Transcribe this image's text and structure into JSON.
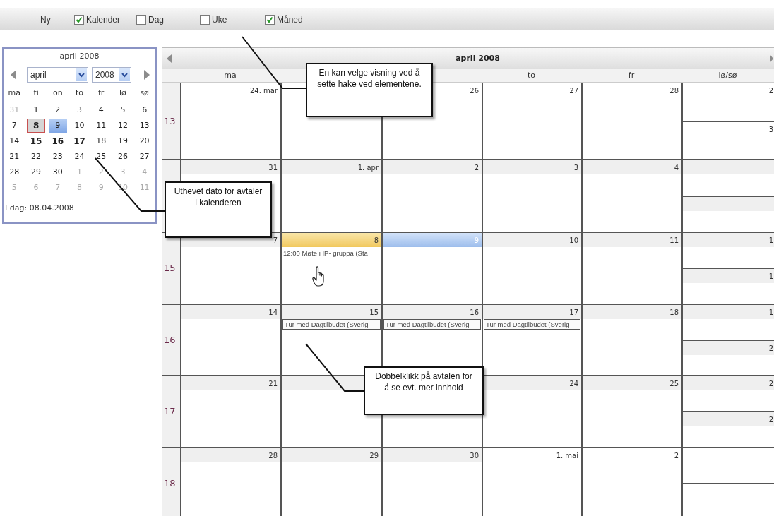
{
  "toolbar": {
    "new_label": "Ny",
    "views": [
      {
        "label": "Kalender",
        "checked": true
      },
      {
        "label": "Dag",
        "checked": false
      },
      {
        "label": "Uke",
        "checked": false
      },
      {
        "label": "Måned",
        "checked": true
      }
    ]
  },
  "mini_calendar": {
    "title": "april 2008",
    "month_select": "april",
    "year_select": "2008",
    "weekdays": [
      "ma",
      "ti",
      "on",
      "to",
      "fr",
      "lø",
      "sø"
    ],
    "weeks": [
      [
        {
          "day": "31",
          "other_month": true,
          "bold": false,
          "today": false,
          "selected": false
        },
        {
          "day": "1",
          "other_month": false,
          "bold": false,
          "today": false,
          "selected": false
        },
        {
          "day": "2",
          "other_month": false,
          "bold": false,
          "today": false,
          "selected": false
        },
        {
          "day": "3",
          "other_month": false,
          "bold": false,
          "today": false,
          "selected": false
        },
        {
          "day": "4",
          "other_month": false,
          "bold": false,
          "today": false,
          "selected": false
        },
        {
          "day": "5",
          "other_month": false,
          "bold": false,
          "today": false,
          "selected": false
        },
        {
          "day": "6",
          "other_month": false,
          "bold": false,
          "today": false,
          "selected": false
        }
      ],
      [
        {
          "day": "7",
          "other_month": false,
          "bold": false,
          "today": false,
          "selected": false
        },
        {
          "day": "8",
          "other_month": false,
          "bold": true,
          "today": true,
          "selected": false
        },
        {
          "day": "9",
          "other_month": false,
          "bold": false,
          "today": false,
          "selected": true
        },
        {
          "day": "10",
          "other_month": false,
          "bold": false,
          "today": false,
          "selected": false
        },
        {
          "day": "11",
          "other_month": false,
          "bold": false,
          "today": false,
          "selected": false
        },
        {
          "day": "12",
          "other_month": false,
          "bold": false,
          "today": false,
          "selected": false
        },
        {
          "day": "13",
          "other_month": false,
          "bold": false,
          "today": false,
          "selected": false
        }
      ],
      [
        {
          "day": "14",
          "other_month": false,
          "bold": false,
          "today": false,
          "selected": false
        },
        {
          "day": "15",
          "other_month": false,
          "bold": true,
          "today": false,
          "selected": false
        },
        {
          "day": "16",
          "other_month": false,
          "bold": true,
          "today": false,
          "selected": false
        },
        {
          "day": "17",
          "other_month": false,
          "bold": true,
          "today": false,
          "selected": false
        },
        {
          "day": "18",
          "other_month": false,
          "bold": false,
          "today": false,
          "selected": false
        },
        {
          "day": "19",
          "other_month": false,
          "bold": false,
          "today": false,
          "selected": false
        },
        {
          "day": "20",
          "other_month": false,
          "bold": false,
          "today": false,
          "selected": false
        }
      ],
      [
        {
          "day": "21",
          "other_month": false,
          "bold": false,
          "today": false,
          "selected": false
        },
        {
          "day": "22",
          "other_month": false,
          "bold": false,
          "today": false,
          "selected": false
        },
        {
          "day": "23",
          "other_month": false,
          "bold": false,
          "today": false,
          "selected": false
        },
        {
          "day": "24",
          "other_month": false,
          "bold": false,
          "today": false,
          "selected": false
        },
        {
          "day": "25",
          "other_month": false,
          "bold": false,
          "today": false,
          "selected": false
        },
        {
          "day": "26",
          "other_month": false,
          "bold": false,
          "today": false,
          "selected": false
        },
        {
          "day": "27",
          "other_month": false,
          "bold": false,
          "today": false,
          "selected": false
        }
      ],
      [
        {
          "day": "28",
          "other_month": false,
          "bold": false,
          "today": false,
          "selected": false
        },
        {
          "day": "29",
          "other_month": false,
          "bold": false,
          "today": false,
          "selected": false
        },
        {
          "day": "30",
          "other_month": false,
          "bold": false,
          "today": false,
          "selected": false
        },
        {
          "day": "1",
          "other_month": true,
          "bold": false,
          "today": false,
          "selected": false
        },
        {
          "day": "2",
          "other_month": true,
          "bold": false,
          "today": false,
          "selected": false
        },
        {
          "day": "3",
          "other_month": true,
          "bold": false,
          "today": false,
          "selected": false
        },
        {
          "day": "4",
          "other_month": true,
          "bold": false,
          "today": false,
          "selected": false
        }
      ],
      [
        {
          "day": "5",
          "other_month": true,
          "bold": false,
          "today": false,
          "selected": false
        },
        {
          "day": "6",
          "other_month": true,
          "bold": false,
          "today": false,
          "selected": false
        },
        {
          "day": "7",
          "other_month": true,
          "bold": false,
          "today": false,
          "selected": false
        },
        {
          "day": "8",
          "other_month": true,
          "bold": false,
          "today": false,
          "selected": false
        },
        {
          "day": "9",
          "other_month": true,
          "bold": false,
          "today": false,
          "selected": false
        },
        {
          "day": "10",
          "other_month": true,
          "bold": false,
          "today": false,
          "selected": false
        },
        {
          "day": "11",
          "other_month": true,
          "bold": false,
          "today": false,
          "selected": false
        }
      ]
    ],
    "footer": "I dag: 08.04.2008"
  },
  "calendar": {
    "title": "april 2008",
    "weekdays": [
      {
        "label": "ma"
      },
      {
        "label": "to"
      },
      {
        "label": "fr"
      },
      {
        "label": "lø/sø"
      }
    ],
    "weeks": [
      {
        "number": "13",
        "days": [
          {
            "date": "24. mar",
            "shaded": false,
            "today": false,
            "selected": false
          },
          {
            "date": "26",
            "shaded": false,
            "today": false,
            "selected": false
          },
          {
            "date": "27",
            "shaded": false,
            "today": false,
            "selected": false
          },
          {
            "date": "28",
            "shaded": false,
            "today": false,
            "selected": false
          }
        ],
        "weekend": [
          {
            "date": "2",
            "shaded": false
          },
          {
            "date": "3",
            "shaded": false
          }
        ]
      },
      {
        "days": [
          {
            "date": "31",
            "shaded": true,
            "today": false,
            "selected": false
          },
          {
            "date": "1. apr",
            "shaded": true,
            "today": false,
            "selected": false
          },
          {
            "date": "2",
            "shaded": true,
            "today": false,
            "selected": false
          },
          {
            "date": "3",
            "shaded": true,
            "today": false,
            "selected": false
          },
          {
            "date": "4",
            "shaded": true,
            "today": false,
            "selected": false
          }
        ],
        "weekend": [
          {
            "shaded": true
          },
          {
            "shaded": true
          }
        ]
      },
      {
        "number": "15",
        "days": [
          {
            "date": "7",
            "shaded": true,
            "today": false,
            "selected": false
          },
          {
            "date": "8",
            "today": true,
            "selected": false,
            "events": [
              {
                "kind": "timed",
                "text": "12:00 Møte i IP- gruppa (Sta"
              }
            ]
          },
          {
            "date": "9",
            "today": false,
            "selected": true
          },
          {
            "date": "10",
            "shaded": true,
            "today": false,
            "selected": false
          },
          {
            "date": "11",
            "shaded": true,
            "today": false,
            "selected": false
          }
        ],
        "weekend": [
          {
            "date": "1",
            "shaded": true
          },
          {
            "date": "1",
            "shaded": true
          }
        ]
      },
      {
        "number": "16",
        "days": [
          {
            "date": "14",
            "shaded": true,
            "today": false,
            "selected": false
          },
          {
            "date": "15",
            "shaded": true,
            "today": false,
            "selected": false,
            "events": [
              {
                "kind": "all_day",
                "text": "Tur med Dagtilbudet (Sverig"
              }
            ]
          },
          {
            "date": "16",
            "shaded": true,
            "today": false,
            "selected": false,
            "events": [
              {
                "kind": "all_day",
                "text": "Tur med Dagtilbudet (Sverig"
              }
            ]
          },
          {
            "date": "17",
            "shaded": true,
            "today": false,
            "selected": false,
            "events": [
              {
                "kind": "all_day",
                "text": "Tur med Dagtilbudet (Sverig"
              }
            ]
          },
          {
            "date": "18",
            "shaded": true,
            "today": false,
            "selected": false
          }
        ],
        "weekend": [
          {
            "date": "1",
            "shaded": true
          },
          {
            "date": "2",
            "shaded": true
          }
        ]
      },
      {
        "number": "17",
        "days": [
          {
            "date": "21",
            "shaded": true,
            "today": false,
            "selected": false
          },
          {
            "shaded": true
          },
          {
            "date": "24",
            "shaded": true,
            "today": false,
            "selected": false
          },
          {
            "date": "25",
            "shaded": true,
            "today": false,
            "selected": false
          }
        ],
        "weekend": [
          {
            "date": "2",
            "shaded": true
          },
          {
            "date": "2",
            "shaded": true
          }
        ]
      },
      {
        "number": "18",
        "days": [
          {
            "date": "28",
            "shaded": true,
            "today": false,
            "selected": false
          },
          {
            "date": "29",
            "shaded": true,
            "today": false,
            "selected": false
          },
          {
            "date": "30",
            "shaded": true,
            "today": false,
            "selected": false
          },
          {
            "date": "1. mai",
            "shaded": false,
            "today": false,
            "selected": false
          },
          {
            "date": "2",
            "shaded": false,
            "today": false,
            "selected": false
          }
        ]
      }
    ]
  },
  "callouts": [
    {
      "text": "En kan velge visning ved å sette hake ved elementene."
    },
    {
      "text": "Uthevet dato for avtaler i kalenderen"
    },
    {
      "text": "Dobbelklikk på avtalen for å se evt. mer innhold"
    }
  ]
}
